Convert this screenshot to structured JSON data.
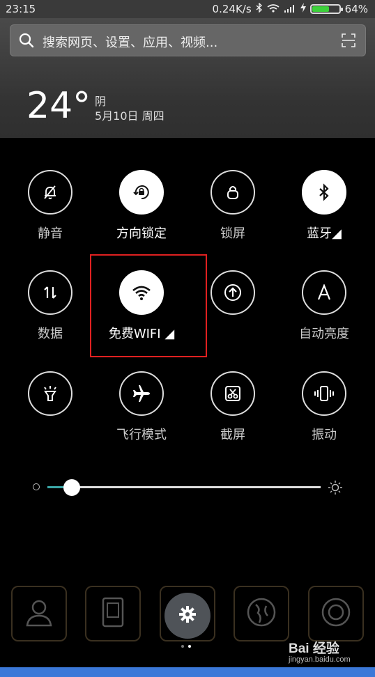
{
  "status_bar": {
    "time": "23:15",
    "speed": "0.24K/s",
    "battery_text": "64%",
    "battery_level": 0.64
  },
  "search": {
    "placeholder": "搜索网页、设置、应用、视频..."
  },
  "weather": {
    "temperature": "24°",
    "condition": "阴",
    "date": "5月10日 周四"
  },
  "toggles": [
    {
      "label": "静音",
      "icon": "bell-off-icon",
      "on": false
    },
    {
      "label": "方向锁定",
      "icon": "rotation-lock-icon",
      "on": true
    },
    {
      "label": "锁屏",
      "icon": "lock-icon",
      "on": false
    },
    {
      "label": "蓝牙◢",
      "icon": "bluetooth-icon",
      "on": true
    },
    {
      "label": "数据",
      "icon": "data-arrows-icon",
      "on": false
    },
    {
      "label": "免费WIFI ◢",
      "icon": "wifi-icon",
      "on": true
    },
    {
      "label": "",
      "icon": "upload-icon",
      "on": false
    },
    {
      "label": "自动亮度",
      "icon": "auto-brightness-icon",
      "on": false
    },
    {
      "label": "",
      "icon": "flashlight-icon",
      "on": false
    },
    {
      "label": "飞行模式",
      "icon": "airplane-icon",
      "on": false
    },
    {
      "label": "截屏",
      "icon": "screenshot-icon",
      "on": false
    },
    {
      "label": "振动",
      "icon": "vibrate-icon",
      "on": false
    }
  ],
  "brightness": {
    "level": 0.09
  },
  "dock": [
    "contacts-icon",
    "phone-frame-icon",
    "settings-gear-icon",
    "browser-globe-icon",
    "camera-icon"
  ],
  "watermark": {
    "main": "Bai 经验",
    "sub": "jingyan.baidu.com"
  },
  "colors": {
    "accent": "#3aa7a7",
    "highlight": "#e02020",
    "battery": "#3dd13b",
    "navbar": "#3b78d8"
  }
}
